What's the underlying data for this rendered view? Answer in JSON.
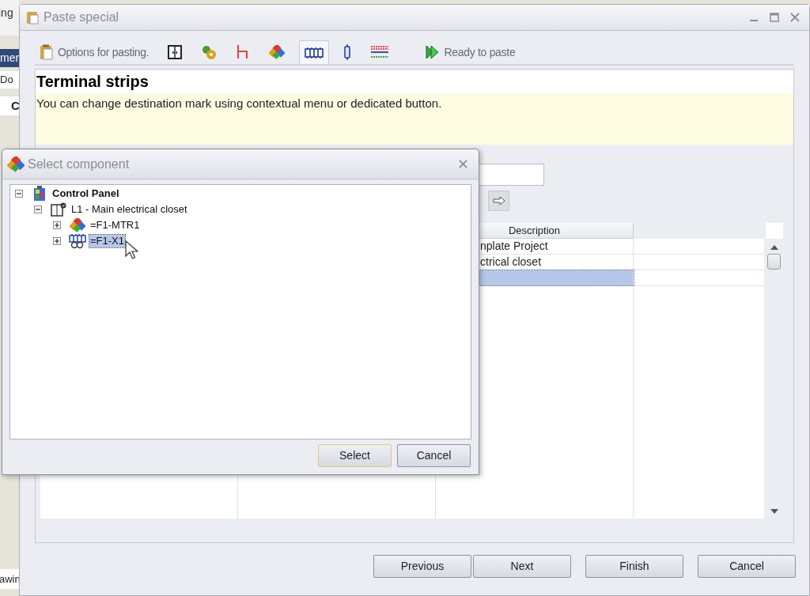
{
  "background_app": {
    "fragments": [
      {
        "kind": "label",
        "text": "ing"
      },
      {
        "kind": "header",
        "text": "mer"
      },
      {
        "kind": "document",
        "text": "Do"
      },
      {
        "kind": "project",
        "text": "C"
      },
      {
        "kind": "footer",
        "text": "awin"
      }
    ]
  },
  "window": {
    "title": "Paste special"
  },
  "steps": [
    {
      "kind": "options",
      "label": "Options for pasting.",
      "selected": false
    },
    {
      "kind": "cabinet",
      "selected": false
    },
    {
      "kind": "component",
      "selected": false
    },
    {
      "kind": "wire",
      "selected": false
    },
    {
      "kind": "parts",
      "selected": false
    },
    {
      "kind": "terminal",
      "selected": true
    },
    {
      "kind": "connector",
      "selected": false
    },
    {
      "kind": "cable",
      "selected": false
    },
    {
      "kind": "ready",
      "label": "Ready to paste",
      "selected": false
    }
  ],
  "panel": {
    "title": "Terminal strips",
    "description": "You can change destination mark using contextual menu or dedicated button."
  },
  "table": {
    "columns": {
      "column_3": "Description"
    },
    "rows": [
      {
        "column_3": "nplate Project",
        "selected": false
      },
      {
        "column_3": "ctrical closet",
        "selected": false
      },
      {
        "selected": true
      }
    ]
  },
  "buttons": [
    "Previous",
    "Next",
    "Finish",
    "Cancel"
  ],
  "select_dialog": {
    "title": "Select component",
    "tree": [
      {
        "kind": "project",
        "label": "Control Panel",
        "expanded": true,
        "selected": false,
        "children": [
          {
            "kind": "location",
            "label": "L1 - Main electrical closet",
            "expanded": true,
            "selected": false,
            "children": [
              {
                "kind": "component",
                "label": "=F1-MTR1",
                "expanded": false,
                "selected": false
              },
              {
                "kind": "terminal",
                "label": "=F1-X1",
                "expanded": false,
                "selected": true
              }
            ]
          }
        ]
      }
    ],
    "buttons": [
      {
        "label": "Select",
        "focused": true
      },
      {
        "label": "Cancel",
        "focused": false
      }
    ]
  }
}
